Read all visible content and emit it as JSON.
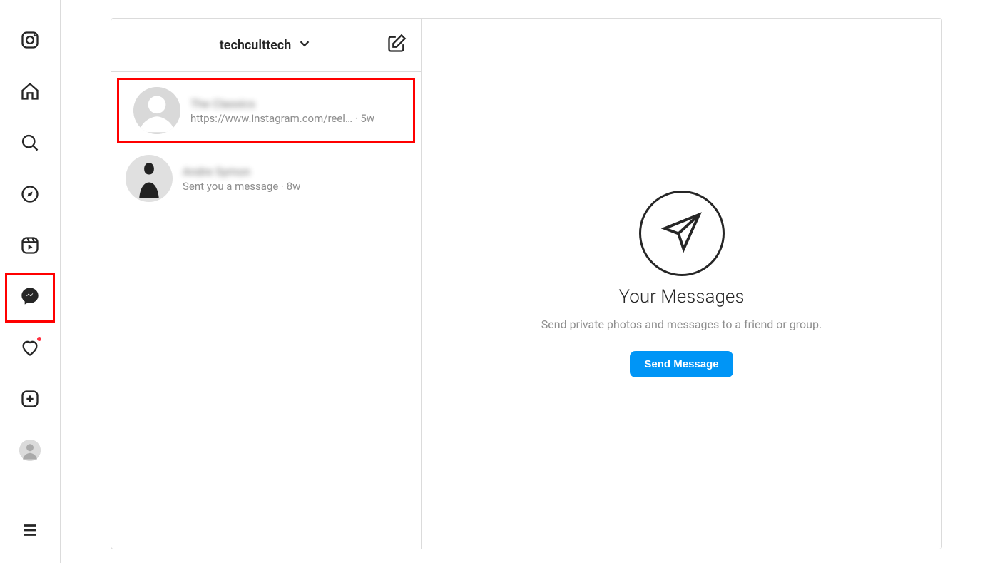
{
  "nav": {
    "items": [
      {
        "name": "instagram-logo-icon"
      },
      {
        "name": "home-icon"
      },
      {
        "name": "search-icon"
      },
      {
        "name": "explore-icon"
      },
      {
        "name": "reels-icon"
      },
      {
        "name": "messages-icon",
        "active": true,
        "highlighted": true
      },
      {
        "name": "notifications-icon",
        "has_dot": true
      },
      {
        "name": "create-icon"
      },
      {
        "name": "profile-avatar"
      }
    ],
    "more_name": "more-menu-icon"
  },
  "inbox": {
    "account_label": "techculttech",
    "threads": [
      {
        "name": "The Classics",
        "preview": "https://www.instagram.com/reel…",
        "time_sep": " · ",
        "time": "5w",
        "highlighted": true,
        "avatar": "default"
      },
      {
        "name": "Andre Symon",
        "preview": "Sent you a message",
        "time_sep": " · ",
        "time": "8w",
        "highlighted": false,
        "avatar": "silhouette"
      }
    ]
  },
  "empty": {
    "title": "Your Messages",
    "subtitle": "Send private photos and messages to a friend or group.",
    "button": "Send Message"
  }
}
